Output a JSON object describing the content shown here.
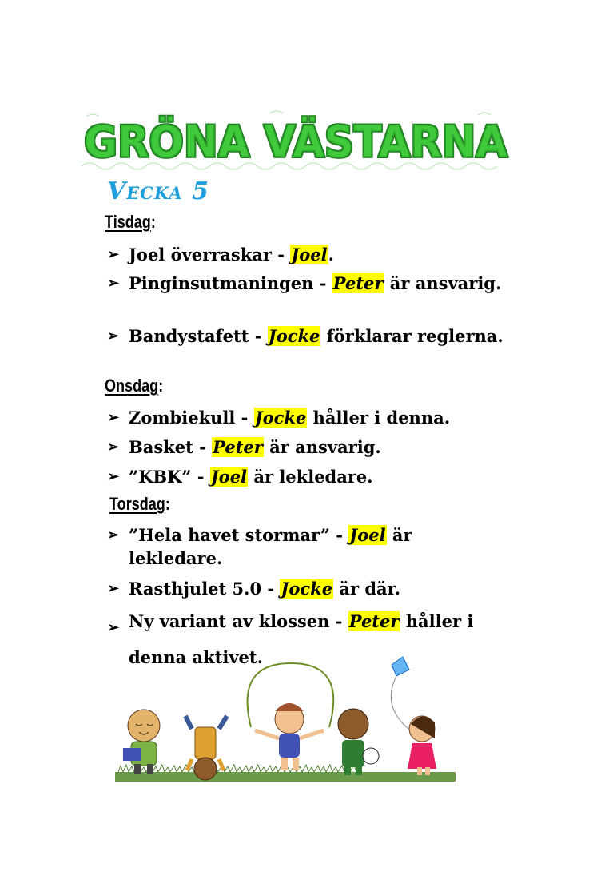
{
  "header": {
    "title": "GRÖNA VÄSTARNA",
    "week": "Vecka 5"
  },
  "bullet": "➢",
  "days": [
    {
      "label": "Tisdag",
      "colon": ":",
      "items": [
        {
          "pre": "Joel överraskar - ",
          "name": "Joel",
          "post": "."
        },
        {
          "pre": "Pinginsutmaningen - ",
          "name": "Peter",
          "post": " är ansvarig."
        },
        {
          "pre": "Bandystafett - ",
          "name": "Jocke",
          "post": " förklarar reglerna."
        }
      ]
    },
    {
      "label": "Onsdag",
      "colon": ":",
      "items": [
        {
          "pre": "Zombiekull - ",
          "name": "Jocke",
          "post": " håller i denna."
        },
        {
          "pre": "Basket - ",
          "name": "Peter",
          "post": " är ansvarig."
        },
        {
          "pre": "”KBK” - ",
          "name": "Joel",
          "post": " är lekledare."
        }
      ]
    },
    {
      "label": "Torsdag",
      "colon": ":",
      "items": [
        {
          "pre": "”Hela havet stormar” - ",
          "name": "Joel",
          "post": " är lekledare."
        },
        {
          "pre": "Rasthjulet 5.0 - ",
          "name": "Jocke",
          "post": " är där."
        },
        {
          "pre": "Ny variant av klossen - ",
          "name": "Peter",
          "post": " håller i denna aktivet."
        }
      ]
    }
  ],
  "colors": {
    "banner": "#3fc93a",
    "week": "#1f9fdc",
    "highlight": "#ffff00"
  }
}
